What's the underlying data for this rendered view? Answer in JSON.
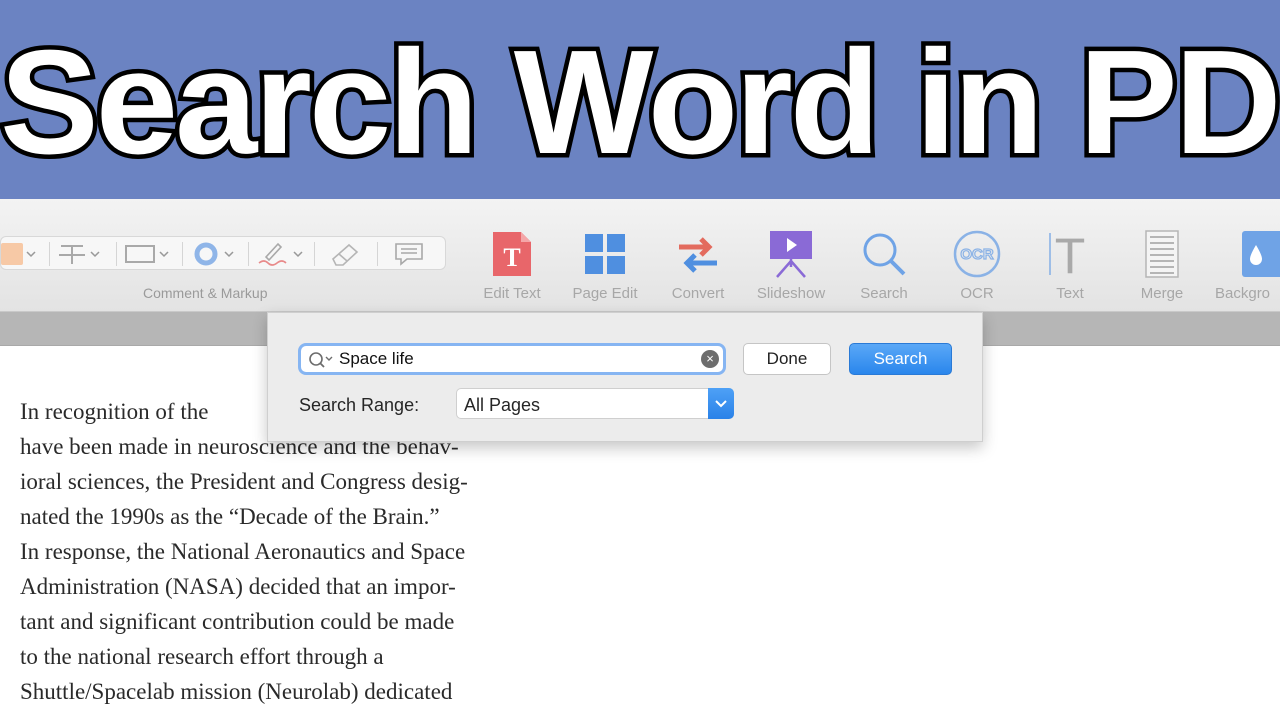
{
  "banner": {
    "title": "Search Word in PDF"
  },
  "toolbar": {
    "markup_group_label": "Comment & Markup",
    "tools": [
      {
        "label": "Edit Text",
        "icon": "edit-text-icon"
      },
      {
        "label": "Page Edit",
        "icon": "page-edit-icon"
      },
      {
        "label": "Convert",
        "icon": "convert-icon"
      },
      {
        "label": "Slideshow",
        "icon": "slideshow-icon"
      },
      {
        "label": "Search",
        "icon": "search-icon"
      },
      {
        "label": "OCR",
        "icon": "ocr-icon"
      },
      {
        "label": "Text",
        "icon": "text-icon"
      },
      {
        "label": "Merge",
        "icon": "merge-icon"
      },
      {
        "label": "Backgro",
        "icon": "background-icon"
      }
    ],
    "edit_text_glyph": "T",
    "ocr_glyph": "OCR",
    "text_glyph": "T"
  },
  "search_panel": {
    "query_value": "Space life",
    "clear_glyph": "×",
    "done_label": "Done",
    "search_label": "Search",
    "range_label": "Search Range:",
    "range_value": "All Pages"
  },
  "document": {
    "lines": [
      "In recognition of the",
      "have been made in neuroscience and the behav-",
      "ioral sciences, the President and Congress desig-",
      "nated the 1990s as the “Decade of the Brain.”",
      "In response, the National Aeronautics and Space",
      "Administration (NASA) decided that an impor-",
      "tant and significant contribution could be made",
      "to the national research effort through a",
      "Shuttle/Spacelab mission (Neurolab) dedicated"
    ]
  },
  "colors": {
    "banner_bg": "#6b83c2",
    "accent_blue": "#2a86ec",
    "edit_text_red": "#e8666a",
    "page_edit_blue": "#4f8fe0",
    "convert_red": "#e36b5e",
    "slideshow_purple": "#8a6ad6"
  }
}
